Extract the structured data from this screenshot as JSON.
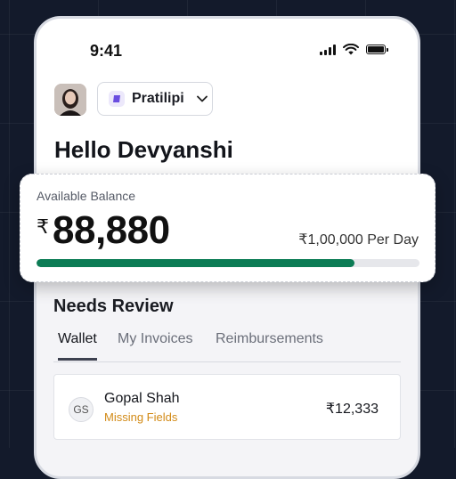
{
  "status_bar": {
    "time": "9:41"
  },
  "header": {
    "org_name": "Pratilipi",
    "greeting": "Hello Devyanshi"
  },
  "balance": {
    "label": "Available Balance",
    "currency_symbol": "₹",
    "amount": "88,880",
    "limit": "₹1,00,000 Per Day",
    "progress_fraction": 0.83,
    "progress_color": "#0c7c55"
  },
  "review": {
    "title": "Needs Review",
    "tabs": [
      {
        "label": "Wallet",
        "active": true
      },
      {
        "label": "My Invoices",
        "active": false
      },
      {
        "label": "Reimbursements",
        "active": false
      }
    ],
    "items": [
      {
        "initials": "GS",
        "name": "Gopal Shah",
        "status": "Missing Fields",
        "amount": "₹12,333",
        "status_color": "#d28a16"
      }
    ]
  },
  "icons": [
    "signal-icon",
    "wifi-icon",
    "battery-icon",
    "org-logo-icon",
    "chevron-down-icon"
  ]
}
